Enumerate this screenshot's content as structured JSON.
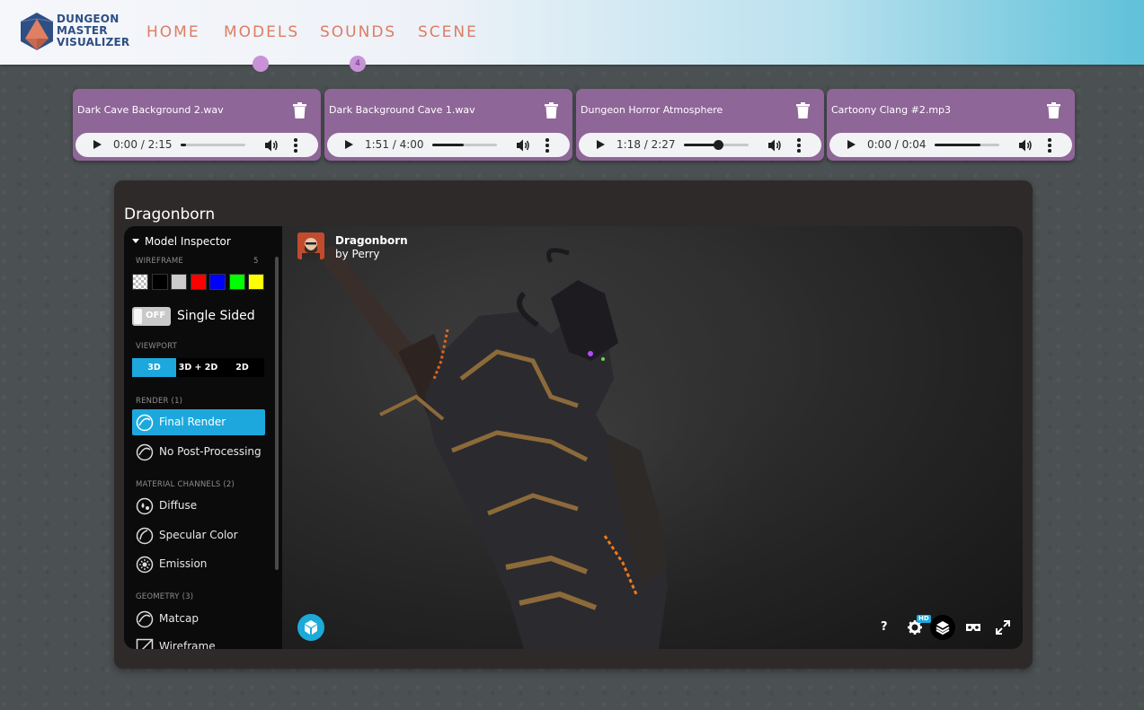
{
  "brand": {
    "logo_text_line1": "DUNGEON",
    "logo_text_line2": "MASTER",
    "logo_text_line3": "VISUALIZER",
    "logo_mark": "DM"
  },
  "nav": {
    "items": [
      {
        "label": "HOME"
      },
      {
        "label": "MODELS"
      },
      {
        "label": "SOUNDS"
      },
      {
        "label": "SCENE"
      }
    ],
    "sounds_badge": "4",
    "accent_color": "#dc7d63",
    "indicator_color": "#c893d6"
  },
  "sounds": [
    {
      "title": "Dark Cave Background 2.wav",
      "time": "0:00 / 2:15",
      "progress": 0.0,
      "knob": false
    },
    {
      "title": "Dark Background Cave 1.wav",
      "time": "1:51 / 4:00",
      "progress": 0.49,
      "knob": false
    },
    {
      "title": "Dungeon Horror Atmosphere",
      "time": "1:18 / 2:27",
      "progress": 0.53,
      "knob": true
    },
    {
      "title": "Cartoony Clang #2.mp3",
      "time": "0:00 / 0:04",
      "progress": 0.71,
      "knob": false
    }
  ],
  "model": {
    "title": "Dragonborn",
    "viewer": {
      "model_name": "Dragonborn",
      "author": "by Perry"
    },
    "inspector": {
      "header": "Model Inspector",
      "wireframe_label": "WIREFRAME",
      "wireframe_count": "5",
      "wireframe_colors": [
        "checker",
        "#000000",
        "#cccccc",
        "#ff0000",
        "#0000ff",
        "#00ff00",
        "#ffff00"
      ],
      "toggle_state": "OFF",
      "toggle_label": "Single Sided",
      "viewport_label": "VIEWPORT",
      "viewport_options": [
        "3D",
        "3D + 2D",
        "2D"
      ],
      "render_label": "RENDER (1)",
      "render_items": [
        "Final Render",
        "No Post-Processing"
      ],
      "material_label": "MATERIAL CHANNELS (2)",
      "material_items": [
        "Diffuse",
        "Specular Color",
        "Emission"
      ],
      "geometry_label": "GEOMETRY (3)",
      "geometry_items": [
        "Matcap",
        "Wireframe"
      ]
    },
    "controls": {
      "help": "?",
      "hd": "HD"
    }
  }
}
